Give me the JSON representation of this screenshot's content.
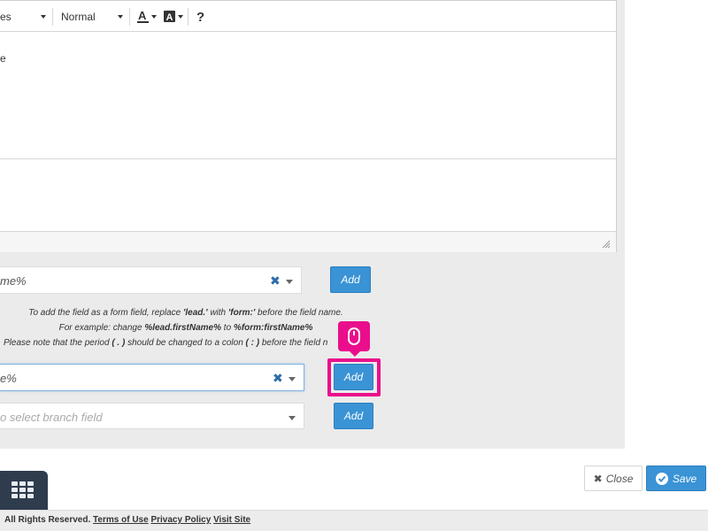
{
  "toolbar": {
    "font_select": "es",
    "size_select": "Normal",
    "help_label": "?"
  },
  "editor": {
    "body_fragment": "e"
  },
  "field_select_1": {
    "value": "me%",
    "add_label": "Add"
  },
  "help": {
    "line1_pre": "To add the field as a form field, replace ",
    "line1_b1": "'lead.'",
    "line1_mid": " with ",
    "line1_b2": "'form:'",
    "line1_post": " before the field name.",
    "line2_pre": "For example: change ",
    "line2_b1": "%lead.firstName%",
    "line2_mid": " to ",
    "line2_b2": "%form:firstName%",
    "line3_pre": "Please note that the period ",
    "line3_b1": "( . )",
    "line3_mid": " should be changed to a colon ",
    "line3_b2": "( : )",
    "line3_post": " before the field n"
  },
  "field_select_2": {
    "value": "e%",
    "add_label": "Add"
  },
  "branch_select": {
    "placeholder": "o select branch field",
    "add_label": "Add"
  },
  "actions": {
    "close_label": "Close",
    "save_label": "Save"
  },
  "footer": {
    "rights": "All Rights Reserved.",
    "terms_link": "Terms of Use",
    "privacy_link": "Privacy Policy",
    "visit_link": "Visit Site"
  },
  "colors": {
    "primary": "#3a93d5",
    "highlight": "#ea0e8c",
    "launcher": "#2f3c4e"
  }
}
